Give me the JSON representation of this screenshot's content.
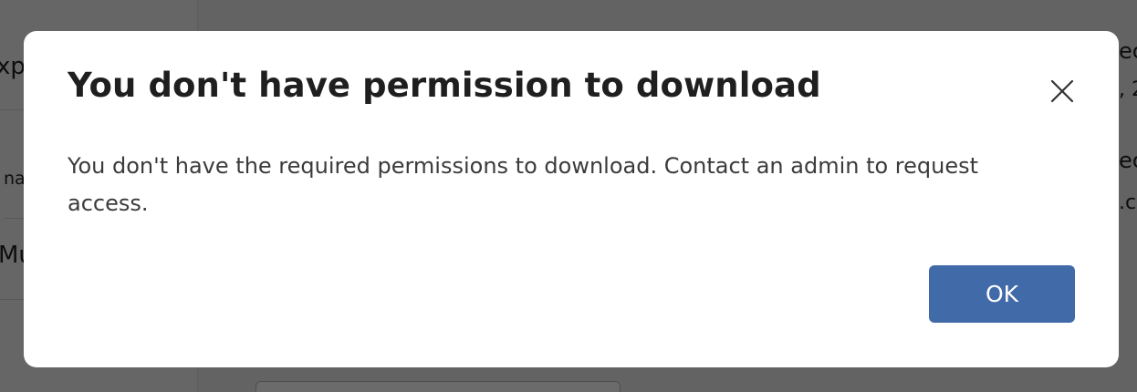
{
  "background": {
    "left_rows": [
      "xp",
      "na",
      "Mu"
    ],
    "right_fragments": [
      "ec",
      ", 2",
      "ec",
      ".c"
    ]
  },
  "dialog": {
    "title": "You don't have permission to download",
    "message": "You don't have the required permissions to download. Contact an admin to request access.",
    "ok_label": "OK",
    "close_icon": "close-icon"
  },
  "colors": {
    "primary_button": "#416aa8",
    "title_text": "#1f1f1f",
    "body_text": "#3b3b3b"
  }
}
